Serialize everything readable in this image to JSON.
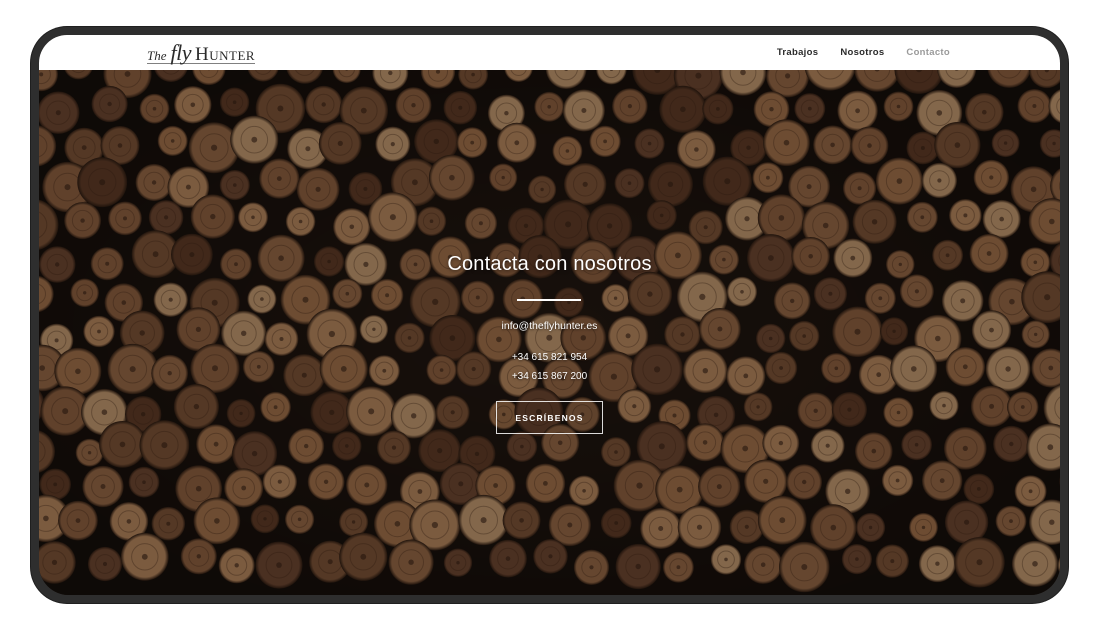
{
  "brand": {
    "the": "The",
    "fly": "fly",
    "hunter": "Hunter"
  },
  "nav": {
    "items": [
      {
        "label": "Trabajos"
      },
      {
        "label": "Nosotros"
      },
      {
        "label": "Contacto"
      }
    ],
    "active_color": "#9a9a9a"
  },
  "hero": {
    "title": "Contacta con nosotros",
    "email": "info@theflyhunter.es",
    "phone_1": "+34 615 821 954",
    "phone_2": "+34 615 867 200",
    "cta_label": "ESCRÍBENOS",
    "background": "stacked-logs-photo"
  }
}
